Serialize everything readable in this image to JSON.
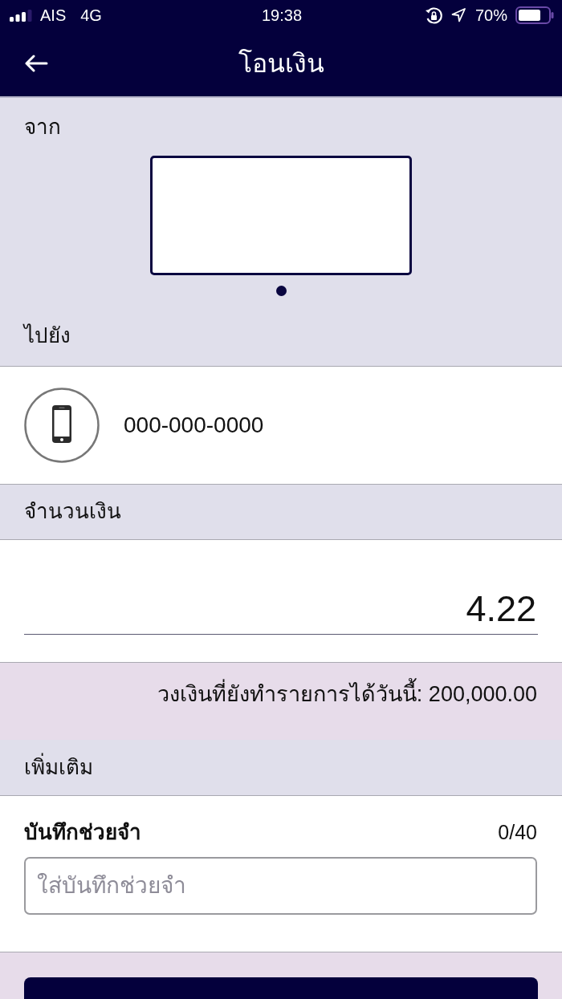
{
  "status_bar": {
    "carrier": "AIS",
    "network": "4G",
    "time": "19:38",
    "battery": "70%"
  },
  "header": {
    "title": "โอนเงิน"
  },
  "from": {
    "label": "จาก",
    "accounts": [
      {
        "selected": true
      }
    ]
  },
  "to": {
    "label": "ไปยัง",
    "recipient": {
      "number": "000-000-0000"
    }
  },
  "amount": {
    "label": "จำนวนเงิน",
    "value": "4.22",
    "limit_note": "วงเงินที่ยังทำรายการได้วันนี้: 200,000.00"
  },
  "more": {
    "label": "เพิ่มเติม",
    "memo": {
      "label": "บันทึกช่วยจำ",
      "counter": "0/40",
      "placeholder": "ใส่บันทึกช่วยจำ"
    }
  }
}
